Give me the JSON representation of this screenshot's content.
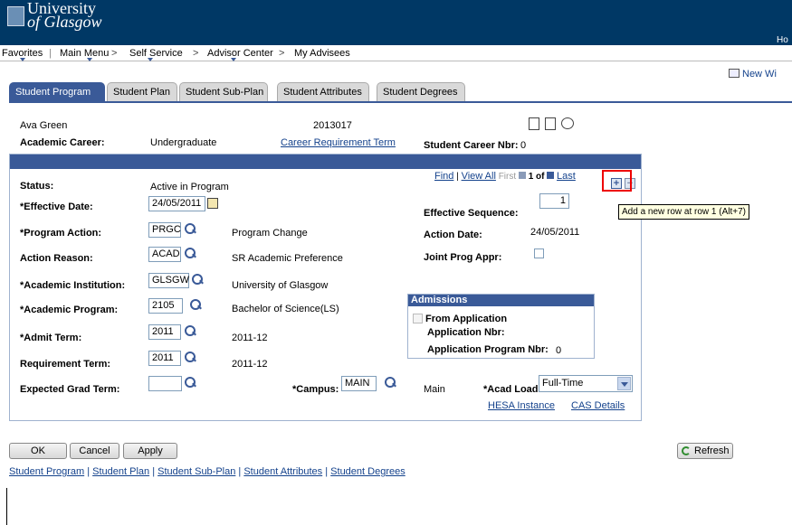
{
  "header": {
    "logo_line1": "University",
    "logo_line2": "of Glasgow",
    "home_link": "Ho"
  },
  "breadcrumb": {
    "favorites": "Favorites",
    "main_menu": "Main Menu",
    "self_service": "Self Service",
    "advisor_center": "Advisor Center",
    "my_advisees": "My Advisees",
    "sep": ">"
  },
  "new_window": "New Wi",
  "tabs": [
    {
      "label": "Student Program"
    },
    {
      "label": "Student Plan"
    },
    {
      "label": "Student Sub-Plan"
    },
    {
      "label": "Student Attributes"
    },
    {
      "label": "Student Degrees"
    }
  ],
  "student": {
    "name": "Ava Green",
    "id": "2013017",
    "career_label": "Academic Career:",
    "career_value": "Undergraduate",
    "career_req_link": "Career Requirement Term",
    "career_nbr_label": "Student Career Nbr:",
    "career_nbr_value": "0"
  },
  "grid_nav": {
    "find": "Find",
    "sep": "|",
    "view_all": "View All",
    "first": "First",
    "range": "1 of",
    "last": "Last"
  },
  "form": {
    "status_label": "Status:",
    "status_value": "Active in Program",
    "eff_date_label": "*Effective Date:",
    "eff_date_value": "24/05/2011",
    "eff_seq_label": "Effective Sequence:",
    "eff_seq_value": "1",
    "prog_action_label": "*Program Action:",
    "prog_action_value": "PRGC",
    "prog_action_desc": "Program Change",
    "action_date_label": "Action Date:",
    "action_date_value": "24/05/2011",
    "action_reason_label": "Action Reason:",
    "action_reason_value": "ACAD",
    "action_reason_desc": "SR Academic Preference",
    "joint_prog_label": "Joint Prog Appr:",
    "acad_inst_label": "*Academic Institution:",
    "acad_inst_value": "GLSGW",
    "acad_inst_desc": "University of Glasgow",
    "acad_prog_label": "*Academic Program:",
    "acad_prog_value": "2105",
    "acad_prog_desc": "Bachelor of Science(LS)",
    "admit_term_label": "*Admit Term:",
    "admit_term_value": "2011",
    "admit_term_desc": "2011-12",
    "req_term_label": "Requirement Term:",
    "req_term_value": "2011",
    "req_term_desc": "2011-12",
    "exp_grad_label": "Expected Grad Term:",
    "exp_grad_value": "",
    "campus_label": "*Campus:",
    "campus_value": "MAIN",
    "campus_desc": "Main",
    "acad_load_label": "*Acad Load:",
    "acad_load_value": "Full-Time",
    "hesa_link": "HESA Instance",
    "cas_link": "CAS Details"
  },
  "admissions": {
    "title": "Admissions",
    "from_app_label": "From Application",
    "app_nbr_label": "Application Nbr:",
    "app_prog_nbr_label": "Application Program Nbr:",
    "app_prog_nbr_value": "0"
  },
  "tooltip": "Add a new row at row 1 (Alt+7)",
  "buttons": {
    "ok": "OK",
    "cancel": "Cancel",
    "apply": "Apply",
    "refresh": "Refresh"
  },
  "bottom_links": [
    "Student Program",
    "Student Plan",
    "Student Sub-Plan",
    "Student Attributes",
    "Student Degrees"
  ],
  "bottom_sep": "|",
  "colors": {
    "header": "#003865",
    "accent": "#3a5a98",
    "link": "#14428c",
    "highlight": "#e00000"
  }
}
